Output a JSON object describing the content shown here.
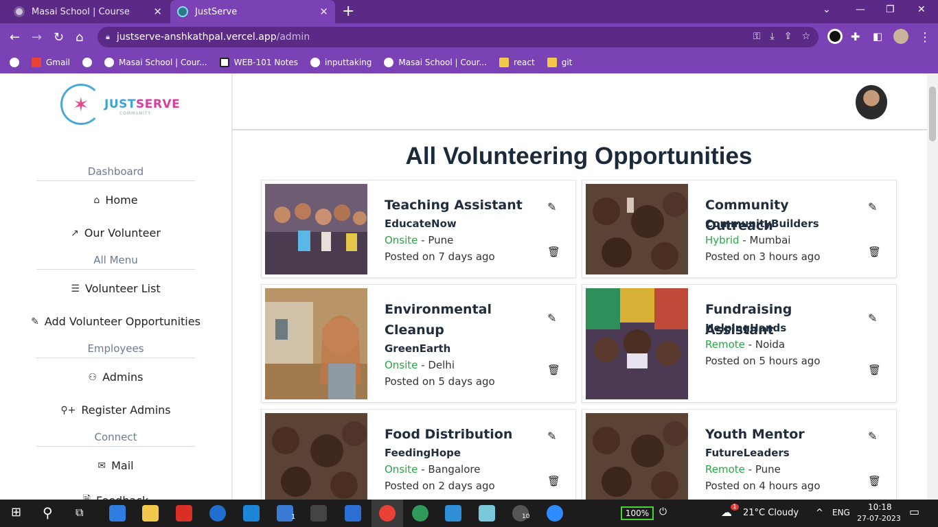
{
  "browser": {
    "tabs": [
      {
        "title": "Masai School | Course",
        "active": false
      },
      {
        "title": "JustServe",
        "active": true
      }
    ],
    "url_host": "justserve-anshkathpal.vercel.app",
    "url_path": "/admin",
    "bookmarks": [
      {
        "label": "Gmail",
        "icon": "gmail-icon"
      },
      {
        "label": "",
        "icon": "globe-icon"
      },
      {
        "label": "Masai School | Cour...",
        "icon": "globe-icon"
      },
      {
        "label": "WEB-101 Notes",
        "icon": "notion-icon"
      },
      {
        "label": "inputtaking",
        "icon": "globe-icon"
      },
      {
        "label": "Masai School | Cour...",
        "icon": "globe-icon"
      },
      {
        "label": "react",
        "icon": "folder-icon"
      },
      {
        "label": "git",
        "icon": "folder-icon"
      }
    ]
  },
  "logo": {
    "word_a": "JUST",
    "word_b": "SERVE",
    "sub": "COMMUNITY"
  },
  "sidebar": {
    "sections": [
      {
        "label": "Dashboard"
      },
      {
        "label": "All Menu"
      },
      {
        "label": "Employees"
      },
      {
        "label": "Connect"
      }
    ],
    "items": [
      {
        "label": "Home",
        "icon": "home-icon"
      },
      {
        "label": "Our Volunteer",
        "icon": "trending-icon"
      },
      {
        "label": "Volunteer List",
        "icon": "list-icon"
      },
      {
        "label": "Add Volunteer Opportunities",
        "icon": "pencil-icon"
      },
      {
        "label": "Admins",
        "icon": "users-icon"
      },
      {
        "label": "Register Admins",
        "icon": "user-plus-icon"
      },
      {
        "label": "Mail",
        "icon": "mail-icon"
      },
      {
        "label": "Feedback",
        "icon": "file-icon"
      }
    ]
  },
  "main": {
    "title": "All Volunteering Opportunities",
    "cards": [
      {
        "title": "Teaching Assistant",
        "org": "EducateNow",
        "mode": "Onsite",
        "city": "Pune",
        "posted": "Posted on 7 days ago"
      },
      {
        "title": "Community Outreach",
        "org": "CommunityBuilders",
        "mode": "Hybrid",
        "city": "Mumbai",
        "posted": "Posted on 3 hours ago"
      },
      {
        "title": "Environmental Cleanup",
        "org": "GreenEarth",
        "mode": "Onsite",
        "city": "Delhi",
        "posted": "Posted on 5 days ago"
      },
      {
        "title": "Fundraising Assistant",
        "org": "HelpingHands",
        "mode": "Remote",
        "city": "Noida",
        "posted": "Posted on 5 hours ago"
      },
      {
        "title": "Food Distribution",
        "org": "FeedingHope",
        "mode": "Onsite",
        "city": "Bangalore",
        "posted": "Posted on 2 days ago"
      },
      {
        "title": "Youth Mentor",
        "org": "FutureLeaders",
        "mode": "Remote",
        "city": "Pune",
        "posted": "Posted on 4 hours ago"
      }
    ]
  },
  "taskbar": {
    "battery": "100%",
    "weather": "21°C  Cloudy",
    "weather_badge": "1",
    "lang": "ENG",
    "time": "10:18",
    "date": "27-07-2023",
    "mail_badge": "1",
    "chrome_badge": "10"
  }
}
